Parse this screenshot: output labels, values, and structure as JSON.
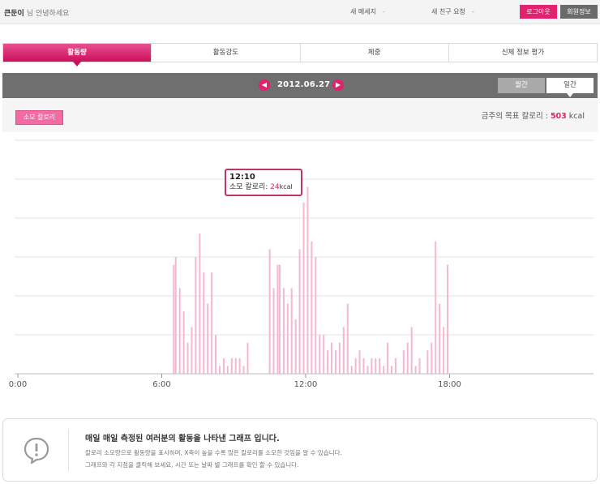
{
  "header": {
    "user_name": "큰둔이",
    "greeting": "님 안녕하세요",
    "new_message_label": "새 메세지",
    "new_message_count": "-",
    "friend_request_label": "새 친구 요청",
    "friend_request_count": "-",
    "logout_label": "로그아웃",
    "member_info_label": "회원정보"
  },
  "tabs": [
    {
      "label": "활동량",
      "active": true
    },
    {
      "label": "활동강도",
      "active": false
    },
    {
      "label": "체중",
      "active": false
    },
    {
      "label": "신체 정보 평가",
      "active": false
    }
  ],
  "datebar": {
    "date": "2012.06.27",
    "prev_glyph": "◀",
    "next_glyph": "▶",
    "monthly_label": "월간",
    "daily_label": "일간"
  },
  "subbar": {
    "calorie_button_label": "소모 칼로리",
    "goal_prefix": "금주의 목표 칼로리 : ",
    "goal_value": "503",
    "goal_unit": " kcal"
  },
  "tooltip": {
    "time": "12:10",
    "label": "소모 칼로리: ",
    "value": "24",
    "unit": "kcal"
  },
  "chart_data": {
    "type": "bar",
    "x_min": 0,
    "x_max": 1440,
    "x_unit": "minutes",
    "x_ticks": [
      {
        "label": "0:00",
        "value": 0
      },
      {
        "label": "6:00",
        "value": 360
      },
      {
        "label": "12:00",
        "value": 720
      },
      {
        "label": "18:00",
        "value": 1080
      }
    ],
    "ylim": [
      0,
      30
    ],
    "grid": true,
    "bar_color": "#f4b8d1",
    "bars": [
      {
        "x": 390,
        "y": 14
      },
      {
        "x": 395,
        "y": 15
      },
      {
        "x": 405,
        "y": 11
      },
      {
        "x": 415,
        "y": 8
      },
      {
        "x": 425,
        "y": 4
      },
      {
        "x": 435,
        "y": 6
      },
      {
        "x": 445,
        "y": 15
      },
      {
        "x": 455,
        "y": 18
      },
      {
        "x": 465,
        "y": 13
      },
      {
        "x": 475,
        "y": 9
      },
      {
        "x": 485,
        "y": 13
      },
      {
        "x": 495,
        "y": 5
      },
      {
        "x": 505,
        "y": 1
      },
      {
        "x": 515,
        "y": 2
      },
      {
        "x": 525,
        "y": 1
      },
      {
        "x": 535,
        "y": 2
      },
      {
        "x": 545,
        "y": 2
      },
      {
        "x": 555,
        "y": 2
      },
      {
        "x": 565,
        "y": 1
      },
      {
        "x": 575,
        "y": 4
      },
      {
        "x": 630,
        "y": 16
      },
      {
        "x": 640,
        "y": 11
      },
      {
        "x": 650,
        "y": 14
      },
      {
        "x": 655,
        "y": 14
      },
      {
        "x": 665,
        "y": 11
      },
      {
        "x": 675,
        "y": 9
      },
      {
        "x": 685,
        "y": 11
      },
      {
        "x": 695,
        "y": 7
      },
      {
        "x": 705,
        "y": 16
      },
      {
        "x": 715,
        "y": 22
      },
      {
        "x": 725,
        "y": 24
      },
      {
        "x": 735,
        "y": 17
      },
      {
        "x": 745,
        "y": 15
      },
      {
        "x": 755,
        "y": 5
      },
      {
        "x": 765,
        "y": 5
      },
      {
        "x": 775,
        "y": 3
      },
      {
        "x": 785,
        "y": 4
      },
      {
        "x": 795,
        "y": 3
      },
      {
        "x": 805,
        "y": 4
      },
      {
        "x": 815,
        "y": 6
      },
      {
        "x": 825,
        "y": 9
      },
      {
        "x": 835,
        "y": 1
      },
      {
        "x": 845,
        "y": 2
      },
      {
        "x": 855,
        "y": 3
      },
      {
        "x": 865,
        "y": 2
      },
      {
        "x": 875,
        "y": 1
      },
      {
        "x": 885,
        "y": 2
      },
      {
        "x": 895,
        "y": 2
      },
      {
        "x": 905,
        "y": 2
      },
      {
        "x": 915,
        "y": 1
      },
      {
        "x": 925,
        "y": 4
      },
      {
        "x": 935,
        "y": 1
      },
      {
        "x": 945,
        "y": 2
      },
      {
        "x": 965,
        "y": 3
      },
      {
        "x": 975,
        "y": 4
      },
      {
        "x": 985,
        "y": 6
      },
      {
        "x": 995,
        "y": 1
      },
      {
        "x": 1005,
        "y": 2
      },
      {
        "x": 1025,
        "y": 3
      },
      {
        "x": 1035,
        "y": 4
      },
      {
        "x": 1045,
        "y": 17
      },
      {
        "x": 1055,
        "y": 9
      },
      {
        "x": 1065,
        "y": 6
      },
      {
        "x": 1075,
        "y": 14
      }
    ]
  },
  "info": {
    "title": "매일 매일 측정된 여러분의 활동을 나타낸 그래프 입니다.",
    "line1": "칼로리 소모량으로 활동량을 표시하며, X축이 높을 수록 많은 칼로리를 소모한 것임을 알 수 있습니다.",
    "line2": "그래프와 각 지점을 클릭해 보세요, 시간 또는 날짜 별 그래프를 확인 할 수 있습니다."
  }
}
